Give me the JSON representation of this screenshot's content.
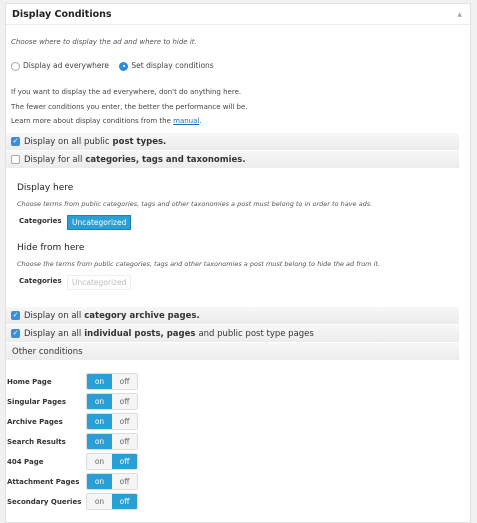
{
  "title": "Display Conditions",
  "intro": "Choose where to display the ad and where to hide it.",
  "radios": [
    {
      "label": "Display ad everywhere",
      "checked": false
    },
    {
      "label": "Set display conditions",
      "checked": true
    }
  ],
  "info": [
    "If you want to display the ad everywhere, don't do anything here.",
    "The fewer conditions you enter, the better the performance will be."
  ],
  "info3_prefix": "Learn more about display conditions from the ",
  "manual_link": "manual",
  "info3_suffix": ".",
  "bar1": {
    "pre": "Display on all public",
    "bold": "post types.",
    "post": ""
  },
  "bar2": {
    "pre": "Display for all",
    "bold": "categories, tags and taxonomies.",
    "post": ""
  },
  "display_here": {
    "title": "Display here",
    "desc": "Choose terms from public categories, tags and other taxonomies a post must belong to in order to have ads.",
    "label": "Categories",
    "tag": "Uncategorized"
  },
  "hide_here": {
    "title": "Hide from here",
    "desc": "Choose the terms from public categories, tags and other taxonomies a post must belong to hide the ad from it.",
    "label": "Categories",
    "tag": "Uncategorized"
  },
  "bar3": {
    "pre": "Display on all",
    "bold": "category archive pages.",
    "post": ""
  },
  "bar4": {
    "pre": "Display an all",
    "bold": "individual posts, pages",
    "post": "and public post type pages"
  },
  "other": "Other conditions",
  "on": "on",
  "off": "off",
  "conditions": [
    {
      "label": "Home Page",
      "value": "on"
    },
    {
      "label": "Singular Pages",
      "value": "on"
    },
    {
      "label": "Archive Pages",
      "value": "on"
    },
    {
      "label": "Search Results",
      "value": "on"
    },
    {
      "label": "404 Page",
      "value": "off"
    },
    {
      "label": "Attachment Pages",
      "value": "on"
    },
    {
      "label": "Secondary Queries",
      "value": "off"
    }
  ]
}
